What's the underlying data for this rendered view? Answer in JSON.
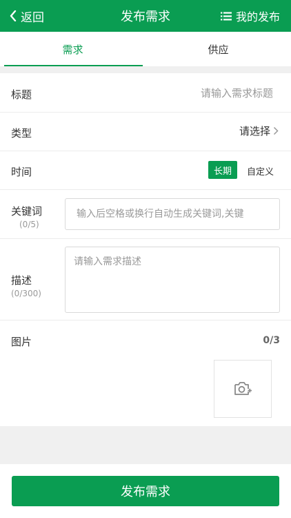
{
  "header": {
    "back_label": "返回",
    "title": "发布需求",
    "my_publish_label": "我的发布"
  },
  "tabs": [
    {
      "label": "需求",
      "active": true
    },
    {
      "label": "供应",
      "active": false
    }
  ],
  "form": {
    "title": {
      "label": "标题",
      "placeholder": "请输入需求标题",
      "value": ""
    },
    "type": {
      "label": "类型",
      "selected": "请选择"
    },
    "time": {
      "label": "时间",
      "options": [
        {
          "label": "长期",
          "active": true
        },
        {
          "label": "自定义",
          "active": false
        }
      ]
    },
    "keywords": {
      "label": "关键词",
      "count": "(0/5)",
      "placeholder": "输入后空格或换行自动生成关键词,关键"
    },
    "description": {
      "label": "描述",
      "count": "(0/300)",
      "placeholder": "请输入需求描述"
    },
    "images": {
      "label": "图片",
      "count": "0/3"
    }
  },
  "footer": {
    "submit_label": "发布需求"
  },
  "colors": {
    "brand": "#0a9d52"
  },
  "icons": {
    "back": "chevron-left-icon",
    "list": "list-icon",
    "arrow": "chevron-right-icon",
    "camera": "camera-add-icon"
  }
}
